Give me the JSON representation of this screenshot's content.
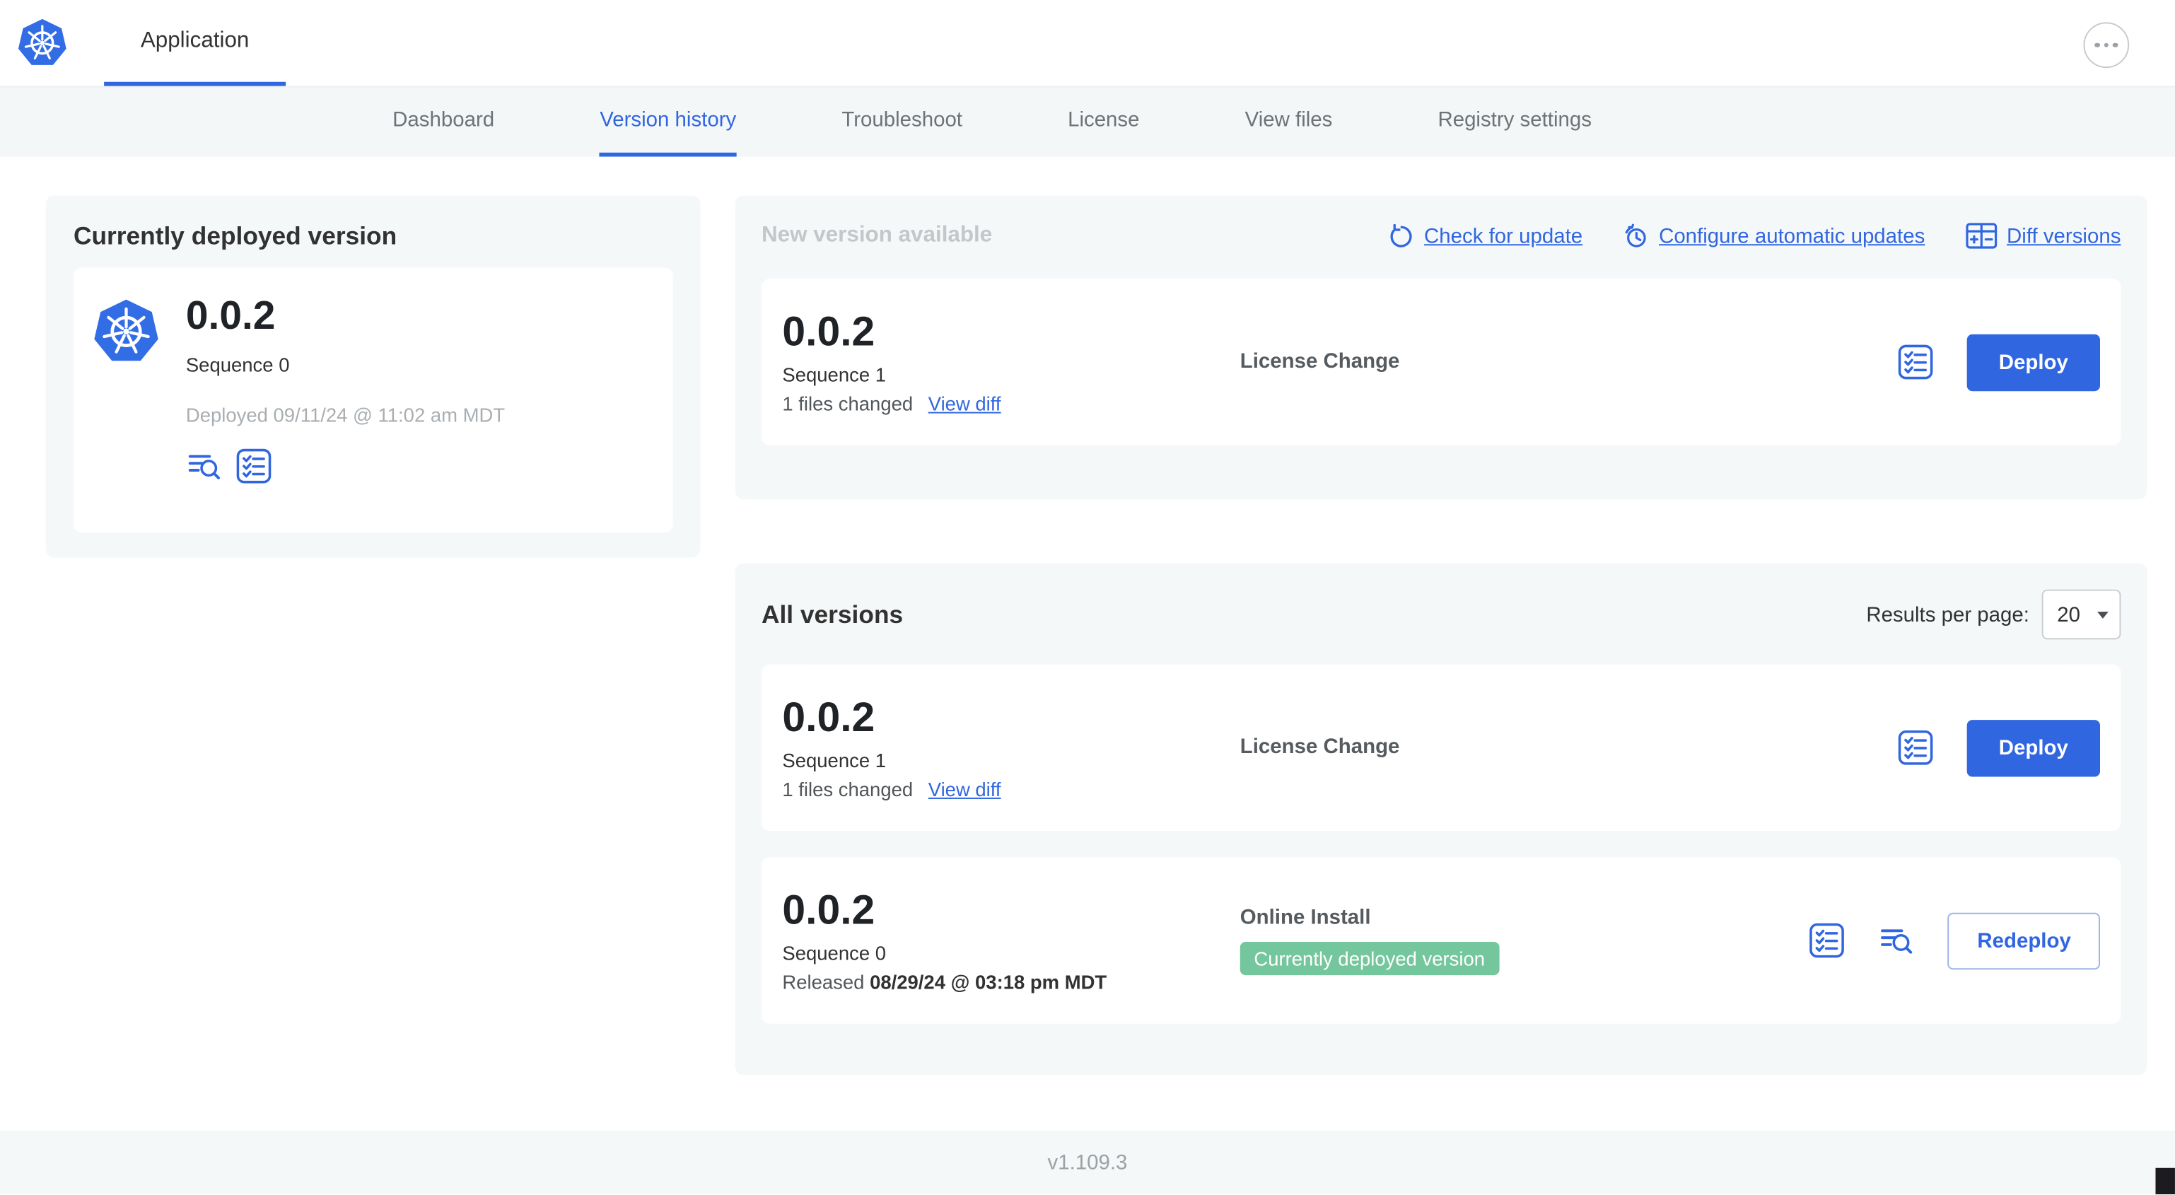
{
  "header": {
    "application_tab": "Application"
  },
  "nav": {
    "tabs": [
      {
        "label": "Dashboard",
        "active": false
      },
      {
        "label": "Version history",
        "active": true
      },
      {
        "label": "Troubleshoot",
        "active": false
      },
      {
        "label": "License",
        "active": false
      },
      {
        "label": "View files",
        "active": false
      },
      {
        "label": "Registry settings",
        "active": false
      }
    ]
  },
  "deployed": {
    "title": "Currently deployed version",
    "version": "0.0.2",
    "sequence": "Sequence 0",
    "deployed_at": "Deployed 09/11/24 @ 11:02 am MDT"
  },
  "new_version": {
    "title": "New version available",
    "actions": {
      "check_for_update": "Check for update",
      "configure_auto_updates": "Configure automatic updates",
      "diff_versions": "Diff versions"
    },
    "row": {
      "version": "0.0.2",
      "sequence": "Sequence 1",
      "files_changed": "1 files changed",
      "view_diff": "View diff",
      "source": "License Change",
      "action": "Deploy"
    }
  },
  "all_versions": {
    "title": "All versions",
    "results_per_page_label": "Results per page:",
    "results_per_page_value": "20",
    "rows": [
      {
        "version": "0.0.2",
        "sequence": "Sequence 1",
        "files_changed": "1 files changed",
        "view_diff": "View diff",
        "source": "License Change",
        "action": "Deploy"
      },
      {
        "version": "0.0.2",
        "sequence": "Sequence 0",
        "released_prefix": "Released",
        "released_date": "08/29/24 @ 03:18 pm MDT",
        "source": "Online Install",
        "badge": "Currently deployed version",
        "action": "Redeploy"
      }
    ]
  },
  "footer": {
    "app_version": "v1.109.3"
  },
  "colors": {
    "accent": "#3066e0",
    "kubernetes_blue": "#326de6",
    "badge_green": "#74c69d",
    "card_background": "#f5f8f9",
    "muted_text": "#9ba1a5"
  },
  "icons": [
    "kubernetes-logo",
    "ellipsis-icon",
    "refresh-icon",
    "clock-update-icon",
    "diff-table-icon",
    "checklist-icon",
    "log-search-icon",
    "chevron-down-icon"
  ]
}
